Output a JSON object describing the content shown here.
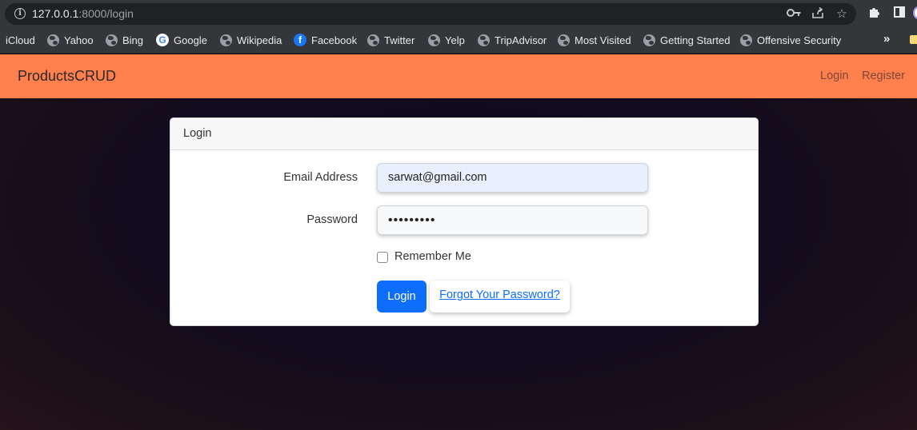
{
  "browser": {
    "url_host": "127.0.0.1",
    "url_path": ":8000/login",
    "icons": [
      "info-icon",
      "key-icon",
      "share-icon",
      "star-icon",
      "extensions-icon",
      "sidepanel-icon",
      "profile-avatar"
    ]
  },
  "bookmarks": [
    {
      "label": "iCloud",
      "icon": "none"
    },
    {
      "label": "Yahoo",
      "icon": "globe-icon"
    },
    {
      "label": "Bing",
      "icon": "globe-icon"
    },
    {
      "label": "Google",
      "icon": "google-icon"
    },
    {
      "label": "Wikipedia",
      "icon": "globe-icon"
    },
    {
      "label": "Facebook",
      "icon": "facebook-icon"
    },
    {
      "label": "Twitter",
      "icon": "globe-icon"
    },
    {
      "label": "Yelp",
      "icon": "globe-icon"
    },
    {
      "label": "TripAdvisor",
      "icon": "globe-icon"
    },
    {
      "label": "Most Visited",
      "icon": "globe-icon"
    },
    {
      "label": "Getting Started",
      "icon": "globe-icon"
    },
    {
      "label": "Offensive Security",
      "icon": "globe-icon"
    }
  ],
  "bookmarks_more": "»",
  "navbar": {
    "brand": "ProductsCRUD",
    "links": [
      "Login",
      "Register"
    ],
    "color": "#ff7f4d"
  },
  "card": {
    "header": "Login",
    "email_label": "Email Address",
    "email_value": "sarwat@gmail.com",
    "password_label": "Password",
    "password_value": "•••••••••",
    "remember_label": "Remember Me",
    "login_button": "Login",
    "forgot_link": "Forgot Your Password?"
  },
  "colors": {
    "primary": "#0d6efd",
    "autofill": "#e8f0fe"
  }
}
